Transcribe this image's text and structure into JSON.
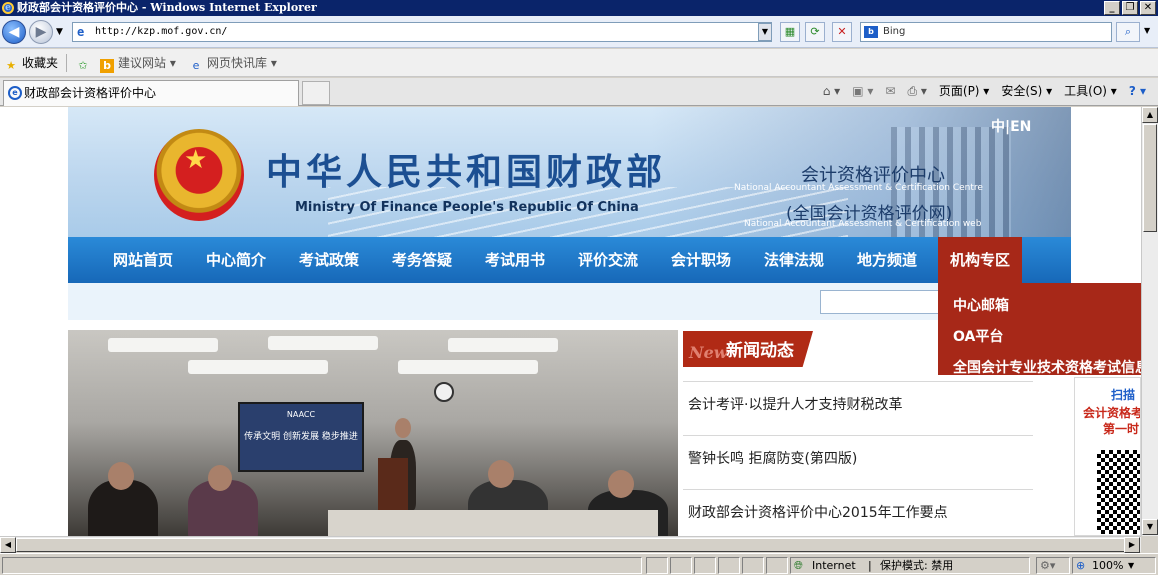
{
  "window": {
    "title": "财政部会计资格评价中心 - Windows Internet Explorer",
    "min": "_",
    "restore": "❐",
    "close": "✕"
  },
  "address_bar": {
    "url": "http://kzp.mof.gov.cn/",
    "search_placeholder": "Bing",
    "search_logo": "b"
  },
  "favorites_bar": {
    "favorites_label": "收藏夹",
    "suggested_sites": "建议网站 ▾",
    "web_slice": "网页快讯库 ▾"
  },
  "tabs": [
    {
      "label": "财政部会计资格评价中心"
    }
  ],
  "command_bar": {
    "page": "页面(P) ▾",
    "safety": "安全(S) ▾",
    "tools": "工具(O) ▾"
  },
  "site": {
    "ministry_cn": "中华人民共和国财政部",
    "ministry_en": "Ministry Of Finance People's Republic Of China",
    "center_cn": "会计资格评价中心",
    "center_en": "National Accountant Assessment & Certification Centre",
    "center_cn2": "(全国会计资格评价网)",
    "center_en2": "National Accountant Assessment & Certification web",
    "lang": "中|EN",
    "nav": [
      "网站首页",
      "中心简介",
      "考试政策",
      "考务答疑",
      "考试用书",
      "评价交流",
      "会计职场",
      "法律法规",
      "地方频道",
      "机构专区"
    ],
    "dropdown": [
      "中心邮箱",
      "OA平台",
      "全国会计专业技术资格考试信息"
    ],
    "photo_slide": {
      "logo": "NAACC",
      "text": "传承文明 创新发展 稳步推进"
    },
    "news": {
      "title_prefix": "New",
      "title": "新闻动态",
      "items": [
        "会计考评·以提升人才支持财税改革",
        "警钟长鸣 拒腐防变(第四版)",
        "财政部会计资格评价中心2015年工作要点"
      ]
    },
    "qr": {
      "t1": "扫描",
      "t2": "会计资格考",
      "t3": "第一时"
    }
  },
  "status_bar": {
    "zone": "Internet",
    "protected_mode": "保护模式: 禁用",
    "zoom": "100%"
  },
  "colors": {
    "nav_blue": "#1768b8",
    "active_red": "#a72818",
    "title_blue": "#1c4f92"
  }
}
